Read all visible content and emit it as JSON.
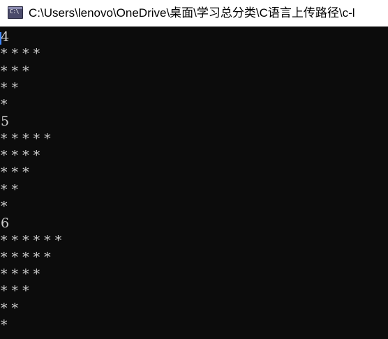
{
  "window": {
    "title": "C:\\Users\\lenovo\\OneDrive\\桌面\\学习总分类\\C语言上传路径\\c-l",
    "icon": "cmd-console-icon",
    "icon_label": "C:\\"
  },
  "console": {
    "lines": [
      "4",
      "* * * *",
      "* * *",
      "* *",
      "*",
      "5",
      "* * * * *",
      "* * * *",
      "* * *",
      "* *",
      "*",
      "6",
      "* * * * * *",
      "* * * * *",
      "* * * *",
      "* * *",
      "* *",
      "*"
    ]
  },
  "colors": {
    "console_background": "#0c0c0c",
    "console_text": "#cccccc",
    "titlebar_background": "#ffffff",
    "caret": "#3f88ff"
  }
}
